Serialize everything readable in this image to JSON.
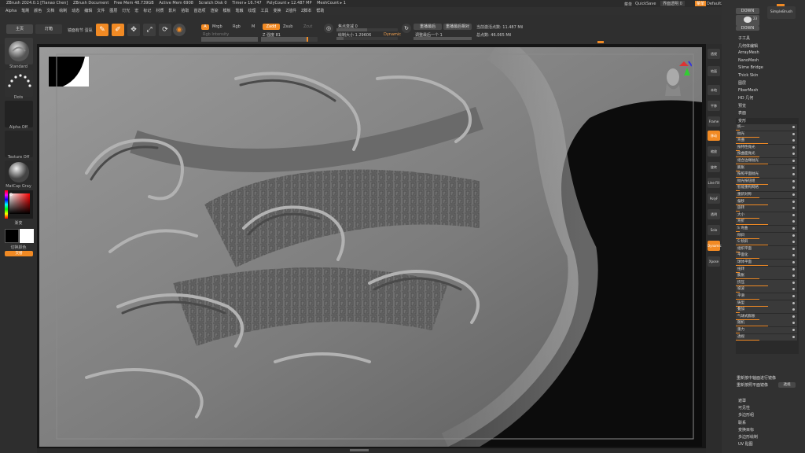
{
  "titlebar": {
    "app": "ZBrush 2024.0.1 [Tianao Chen]",
    "document": "ZBrush Document",
    "free_mem": "Free Mem 48.739GB",
    "active_mem": "Active Mem 6908",
    "scratch_disk": "Scratch Disk 0",
    "timer": "Timer ▸ 16.747",
    "polycount": "PolyCount ▸ 12.487 MP",
    "meshcount": "MeshCount ▸ 1",
    "menus_label": "菜单",
    "quicksave": "QuickSave",
    "transparency": "界面透明 0",
    "default_script": "DefaultZScript"
  },
  "menubar": [
    "Alpha",
    "笔刷",
    "颜色",
    "文档",
    "绘制",
    "动态",
    "编辑",
    "文件",
    "图层",
    "灯光",
    "宏",
    "标记",
    "材质",
    "影片",
    "拾取",
    "首选项",
    "渲染",
    "模板",
    "笔触",
    "纹理",
    "工具",
    "变换",
    "Z插件",
    "Z脚本",
    "帮助"
  ],
  "topshelf": {
    "home": "主页",
    "lightbox": "灯箱",
    "project_label": "镜面有节 蛋氨",
    "edit": "Edit",
    "draw": "Draw",
    "move": "Move",
    "scale": "Scale",
    "rotate": "Rotate",
    "a_label": "A",
    "mrgb": "Mrgb",
    "rgb": "Rgb",
    "m_label": "M",
    "zadd": "Zadd",
    "zsub": "Zsub",
    "zcut": "Zcut",
    "rgb_intensity": "Rgb Intensity",
    "z_intensity": "Z 强度 81",
    "focal_shift": "焦点衰减 0",
    "draw_size": "绘制大小 1.29606",
    "dynamic": "Dynamic",
    "replay_last": "重播最后",
    "replay_last_rel": "重播最后相对",
    "adjust_last": "调整最后一个 1",
    "active_points": "当前激活点数: 11.487 Mil",
    "total_points": "总点数: 46.065 Mil"
  },
  "leftshelf": {
    "brush_label": "Standard",
    "stroke_label": "Dots",
    "alpha_label": "Alpha Off",
    "texture_label": "Texture Off",
    "material_label": "MatCap Gray",
    "gradient_label": "渐变",
    "swatch_label": "切换颜色",
    "alternate_label": "交替"
  },
  "rightshelf": [
    "透视",
    "地面",
    "本地",
    "平移",
    "Frame",
    "移动",
    "缩放",
    "旋转",
    "Line Fill",
    "PolyF",
    "透明",
    "Solo",
    "Dynamic",
    "Xpose"
  ],
  "rightpanel": {
    "brush_a": "DOWN",
    "brush_count": "23",
    "brush_b": "DOWN",
    "brush_name": "SimpleBrush",
    "subtools": [
      "子工具",
      "几何体编辑",
      "ArrayMesh",
      "NanoMesh",
      "Slime Bridge",
      "Thick Skin",
      "图层",
      "FiberMesh",
      "HD 几何",
      "预览",
      "表面"
    ],
    "deformation_header": "变形",
    "rows": [
      "统一",
      "抛光",
      "弯曲",
      "按特性抛光",
      "按曲面抛光",
      "组合边缘抛光",
      "膨胀",
      "按照平面抛光",
      "抛光按钮组",
      "智能重构网格",
      "重新对称",
      "偏移",
      "旋转",
      "大小",
      "弯折",
      "S 弯曲",
      "倾斜",
      "S 倾斜",
      "组织平面",
      "平面化",
      "球体平面",
      "扭转",
      "膨胀",
      "挤压",
      "噪波",
      "平滑",
      "铸型",
      "叠加",
      "气球式膨胀",
      "随机",
      "重力",
      "透视"
    ],
    "bottom_items": [
      "重新按中轴面进行镜像",
      "重新按照平面镜像",
      "遮罩",
      "可见性",
      "多边形组",
      "联系",
      "变换目标",
      "多边形绘制",
      "UV 贴图"
    ],
    "apply_label": "透视"
  }
}
